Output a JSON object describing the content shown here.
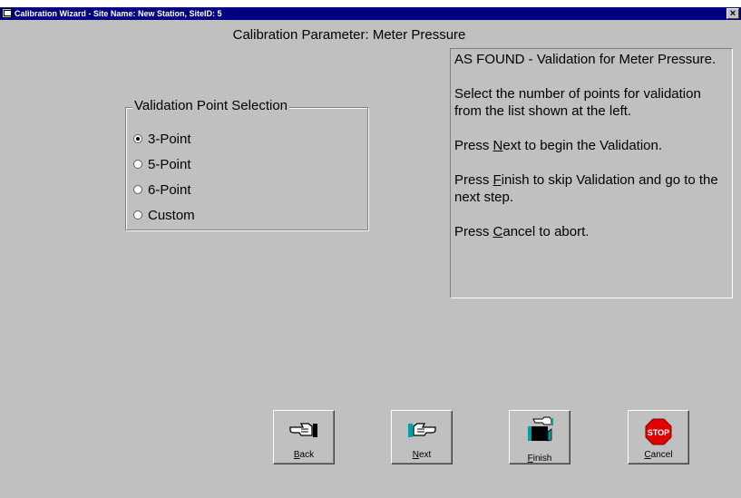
{
  "window": {
    "title": "Calibration Wizard - Site Name: New Station, SiteID: 5",
    "close_label": "×"
  },
  "heading": "Calibration Parameter: Meter Pressure",
  "group": {
    "label": "Validation Point Selection",
    "options": [
      {
        "label": "3-Point",
        "checked": true
      },
      {
        "label": "5-Point",
        "checked": false
      },
      {
        "label": "6-Point",
        "checked": false
      },
      {
        "label": "Custom",
        "checked": false
      }
    ]
  },
  "info": {
    "line1": "AS FOUND - Validation for Meter Pressure.",
    "line2": "Select the number of points for validation from the list shown at the left.",
    "line3_pre": "Press ",
    "line3_key": "N",
    "line3_rest": "ext to begin the Validation.",
    "line4_pre": "Press ",
    "line4_key": "F",
    "line4_rest": "inish to skip Validation and go to the next step.",
    "line5_pre": "Press ",
    "line5_key": "C",
    "line5_rest": "ancel to abort."
  },
  "buttons": {
    "back": {
      "key": "B",
      "rest": "ack",
      "icon": "hand-pointing-left-icon"
    },
    "next": {
      "key": "N",
      "rest": "ext",
      "icon": "hand-pointing-right-icon"
    },
    "finish": {
      "key": "F",
      "rest": "inish",
      "icon": "finish-flag-icon"
    },
    "cancel": {
      "key": "C",
      "rest": "ancel",
      "icon": "stop-sign-icon",
      "icon_text": "STOP"
    }
  },
  "colors": {
    "titlebar": "#000080",
    "face": "#c0c0c0",
    "stop": "#e00000",
    "teal": "#00a0a0"
  }
}
